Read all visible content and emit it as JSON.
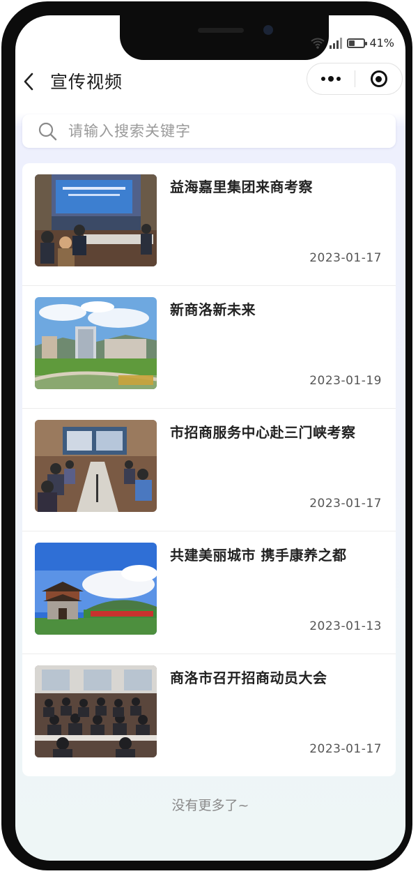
{
  "status_bar": {
    "battery_percent": "41%",
    "battery_level": 0.41,
    "icons": [
      "wifi-icon",
      "signal-icon",
      "battery-icon"
    ]
  },
  "nav": {
    "title": "宣传视频",
    "back_icon": "chevron-left-icon",
    "more_icon": "more-dots-icon",
    "close_icon": "target-circle-icon"
  },
  "search": {
    "placeholder": "请输入搜索关键字",
    "value": "",
    "icon": "search-icon"
  },
  "videos": [
    {
      "title": "益海嘉里集团来商考察",
      "date": "2023-01-17",
      "thumbnail": "meeting-room-screen"
    },
    {
      "title": "新商洛新未来",
      "date": "2023-01-19",
      "thumbnail": "city-skyline"
    },
    {
      "title": "市招商服务中心赴三门峡考察",
      "date": "2023-01-17",
      "thumbnail": "conference-table"
    },
    {
      "title": "共建美丽城市 携手康养之都",
      "date": "2023-01-13",
      "thumbnail": "city-gate-tower"
    },
    {
      "title": "商洛市召开招商动员大会",
      "date": "2023-01-17",
      "thumbnail": "auditorium-meeting"
    }
  ],
  "footer": {
    "no_more_text": "没有更多了~"
  },
  "colors": {
    "page_background": "#eef0fd",
    "card_background": "#ffffff",
    "title_text": "#222222",
    "date_text": "#555555",
    "muted_text": "#8a8a8a"
  }
}
